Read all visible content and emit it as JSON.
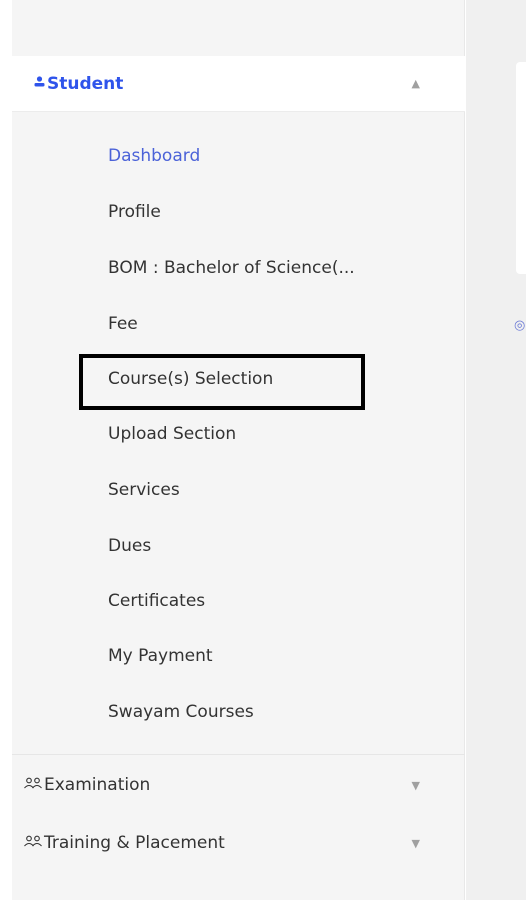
{
  "sidebar": {
    "student": {
      "icon": "user-icon",
      "label": "Student",
      "expanded": true,
      "items": [
        {
          "label": "Dashboard",
          "active": true
        },
        {
          "label": "Profile"
        },
        {
          "label": "BOM : Bachelor of Science(..."
        },
        {
          "label": "Fee"
        },
        {
          "label": "Course(s) Selection",
          "highlighted": true
        },
        {
          "label": "Upload Section"
        },
        {
          "label": "Services"
        },
        {
          "label": "Dues"
        },
        {
          "label": "Certificates"
        },
        {
          "label": "My Payment"
        },
        {
          "label": "Swayam Courses"
        }
      ]
    },
    "examination": {
      "icon": "users-icon",
      "label": "Examination",
      "expanded": false
    },
    "training": {
      "icon": "users-icon",
      "label": "Training & Placement",
      "expanded": false
    }
  },
  "colors": {
    "accent": "#2f54eb",
    "active_item": "#4b62d8",
    "text": "#333333",
    "sidebar_bg": "#f5f5f5",
    "highlight_border": "#000000"
  }
}
